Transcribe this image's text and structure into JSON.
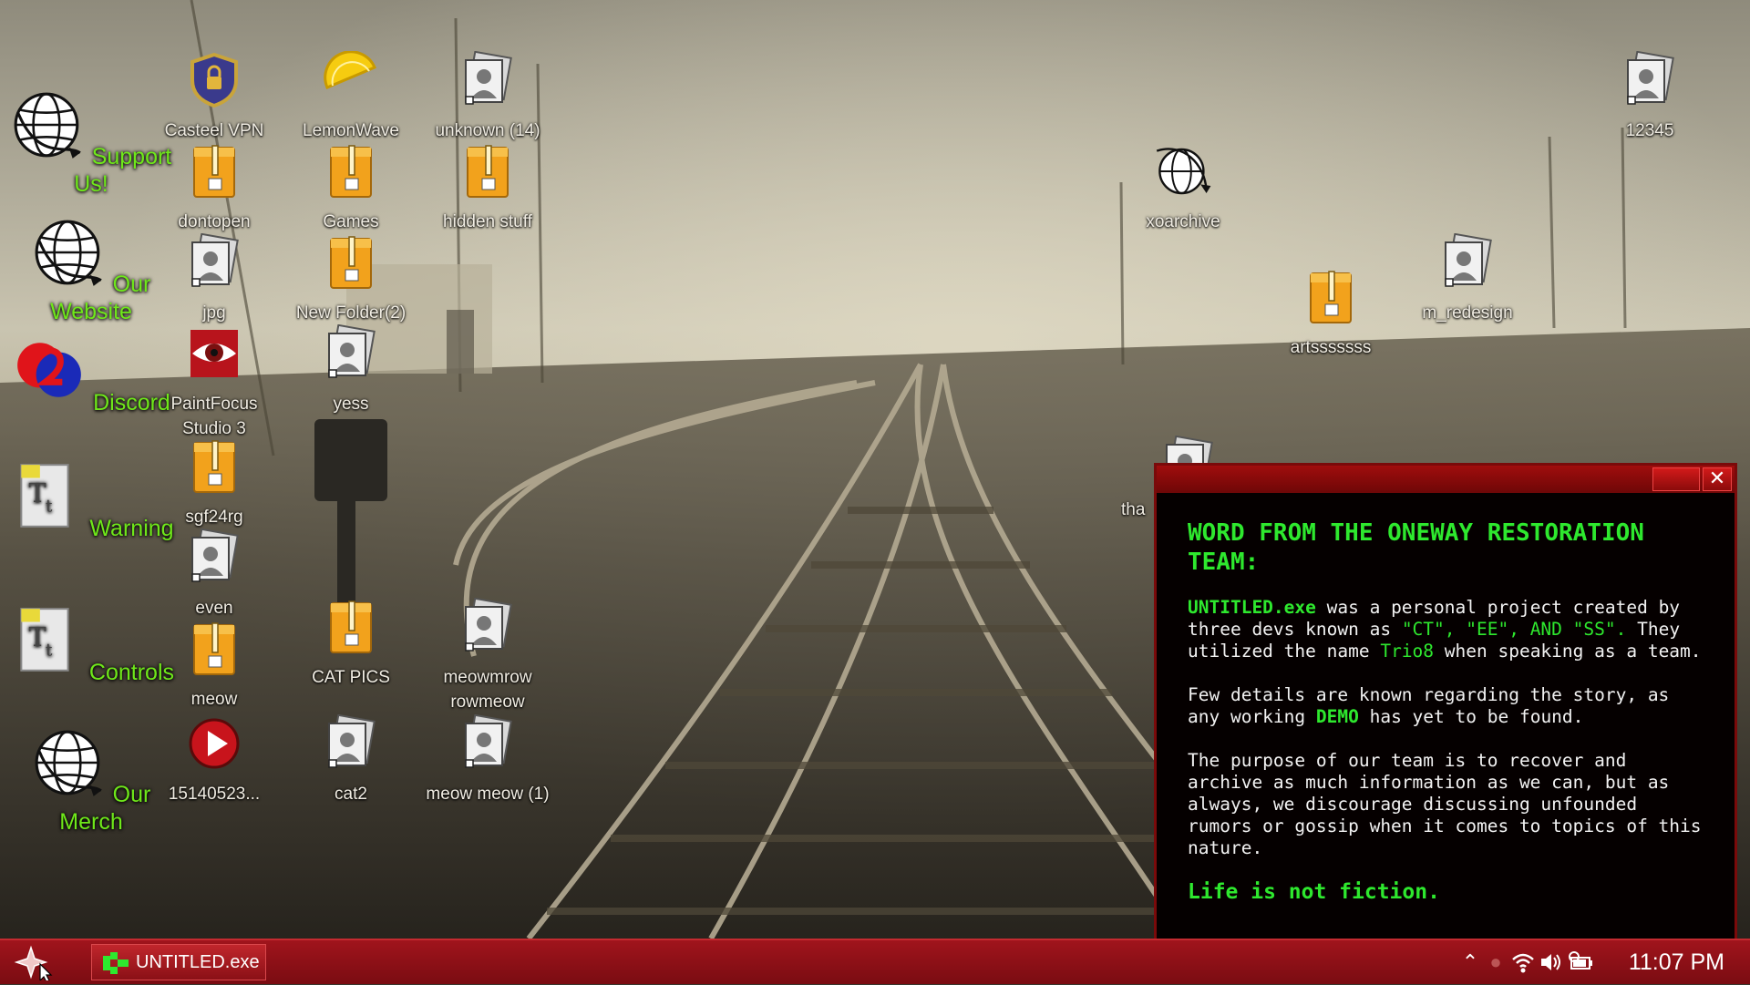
{
  "left_links": [
    {
      "label": "Support Us!",
      "icon": "globe-icon"
    },
    {
      "label": "Our Website",
      "icon": "globe-icon"
    },
    {
      "label": "Discord",
      "icon": "discord-icon"
    },
    {
      "label": "Warning",
      "icon": "text-document-icon"
    },
    {
      "label": "Controls",
      "icon": "text-document-icon"
    },
    {
      "label": "Our Merch",
      "icon": "globe-icon"
    }
  ],
  "icons": {
    "casteel_vpn": "Casteel VPN",
    "lemonwave": "LemonWave",
    "unknown14": "unknown (14)",
    "dontopen": "dontopen",
    "games": "Games",
    "hidden_stuff": "hidden stuff",
    "jpg": "jpg",
    "new_folder2": "New Folder(2)",
    "paintfocus_1": "PaintFocus",
    "paintfocus_2": "Studio 3",
    "yess": "yess",
    "sgf24rg": "sgf24rg",
    "even": "even",
    "meow": "meow",
    "cat_pics": "CAT PICS",
    "meowmrow_1": "meowmrow",
    "meowmrow_2": "rowmeow",
    "video": "15140523...",
    "cat2": "cat2",
    "meow_meow1": "meow meow (1)",
    "xoarchive": "xoarchive",
    "artssssss": "artsssssss",
    "m_redesign": "m_redesign",
    "n12345": "12345",
    "tha": "tha"
  },
  "popup": {
    "heading": "WORD FROM THE ONEWAY RESTORATION TEAM:",
    "p1_a": "UNTITLED.exe",
    "p1_b": " was a personal project created by three devs known as ",
    "p1_c": "\"CT\", \"EE\", AND \"SS\".",
    "p1_d": " They utilized the name ",
    "p1_e": "Trio8",
    "p1_f": " when speaking as a team.",
    "p2_a": "Few details are known regarding the story, as any working ",
    "p2_b": "DEMO",
    "p2_c": " has yet to be found.",
    "p3": "The purpose of our team is to recover and archive as much information as we can, but as always, we discourage discussing unfounded rumors or gossip when it comes to topics of this nature.",
    "motto": "Life is not fiction."
  },
  "taskbar": {
    "task_label": "UNTITLED.exe",
    "clock": "11:07 PM"
  },
  "colors": {
    "accent_green": "#2ee82e",
    "link_green": "#6fe81a",
    "taskbar_red": "#a0141c"
  }
}
